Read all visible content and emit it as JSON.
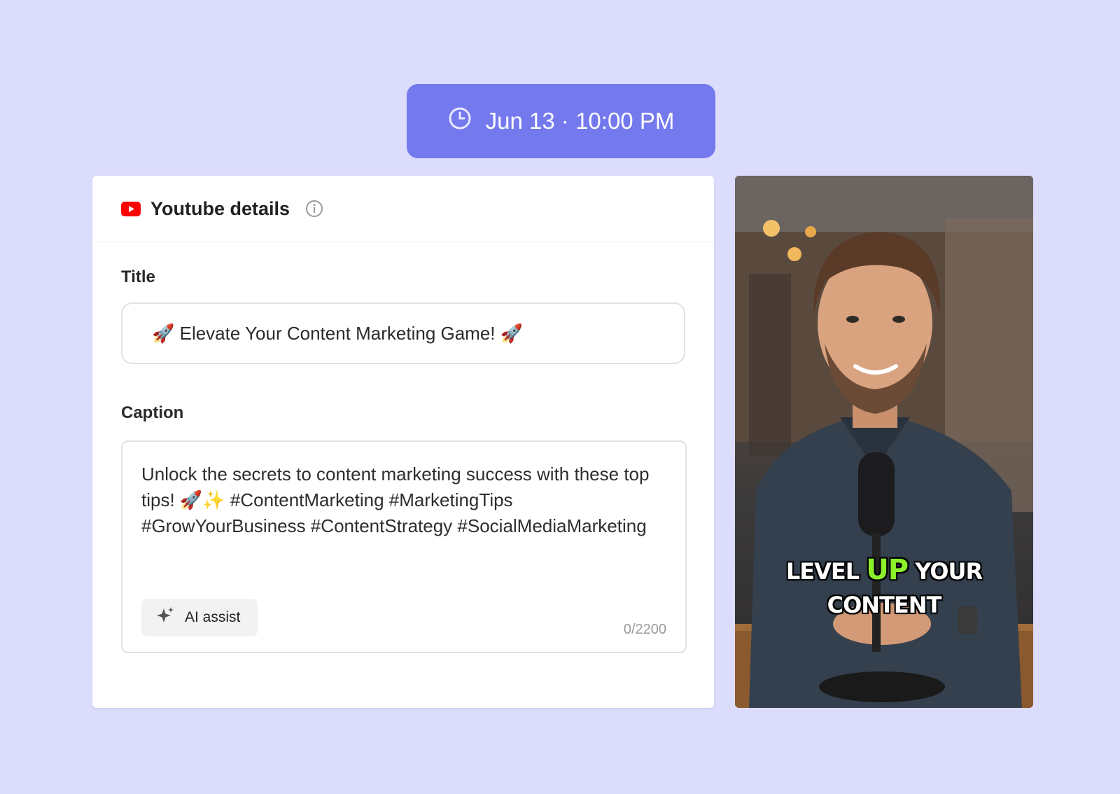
{
  "schedule": {
    "label": "Jun 13 · 10:00 PM",
    "icon": "clock-icon"
  },
  "card": {
    "platform_icon": "youtube-icon",
    "title": "Youtube details",
    "info_icon": "info-icon"
  },
  "title_field": {
    "label": "Title",
    "value": "🚀 Elevate Your Content Marketing Game! 🚀"
  },
  "caption_field": {
    "label": "Caption",
    "value": "Unlock the secrets to content marketing success with these top tips! 🚀✨ #ContentMarketing #MarketingTips #GrowYourBusiness #ContentStrategy #SocialMediaMarketing",
    "counter": "0/2200"
  },
  "ai_assist": {
    "label": "AI assist",
    "icon": "sparkle-icon"
  },
  "thumbnail": {
    "overlay_word1": "LEVEL",
    "overlay_accent": "UP",
    "overlay_word2": "YOUR",
    "overlay_line2": "CONTENT",
    "accent_color": "#8cf02a"
  },
  "colors": {
    "background": "#dcdcfd",
    "schedule_pill": "#7479ee",
    "youtube_red": "#ff0000"
  }
}
